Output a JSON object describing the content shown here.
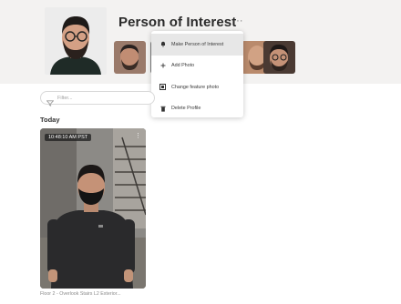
{
  "profile": {
    "title": "Person of Interest",
    "more_glyph": "···"
  },
  "thumbnails": [
    {
      "name": "face-thumb-1"
    },
    {
      "name": "face-thumb-2"
    },
    {
      "name": "face-thumb-3"
    },
    {
      "name": "face-thumb-4"
    },
    {
      "name": "face-thumb-5"
    }
  ],
  "menu": {
    "items": [
      {
        "label": "Make Person of Interest",
        "icon": "bell-icon"
      },
      {
        "label": "Add Photo",
        "icon": "plus-icon"
      },
      {
        "label": "Change feature photo",
        "icon": "image-frame-icon"
      },
      {
        "label": "Delete Profile",
        "icon": "trash-icon"
      }
    ]
  },
  "filter": {
    "placeholder": "Filter..."
  },
  "section": {
    "today": "Today"
  },
  "event": {
    "time": "10:48:10 AM PST",
    "caption": "Floor 2 - Overlook Stairs L2 Exterior..."
  },
  "colors": {
    "header_bg": "#f3f2f1",
    "menu_active": "#e7e7e7"
  }
}
